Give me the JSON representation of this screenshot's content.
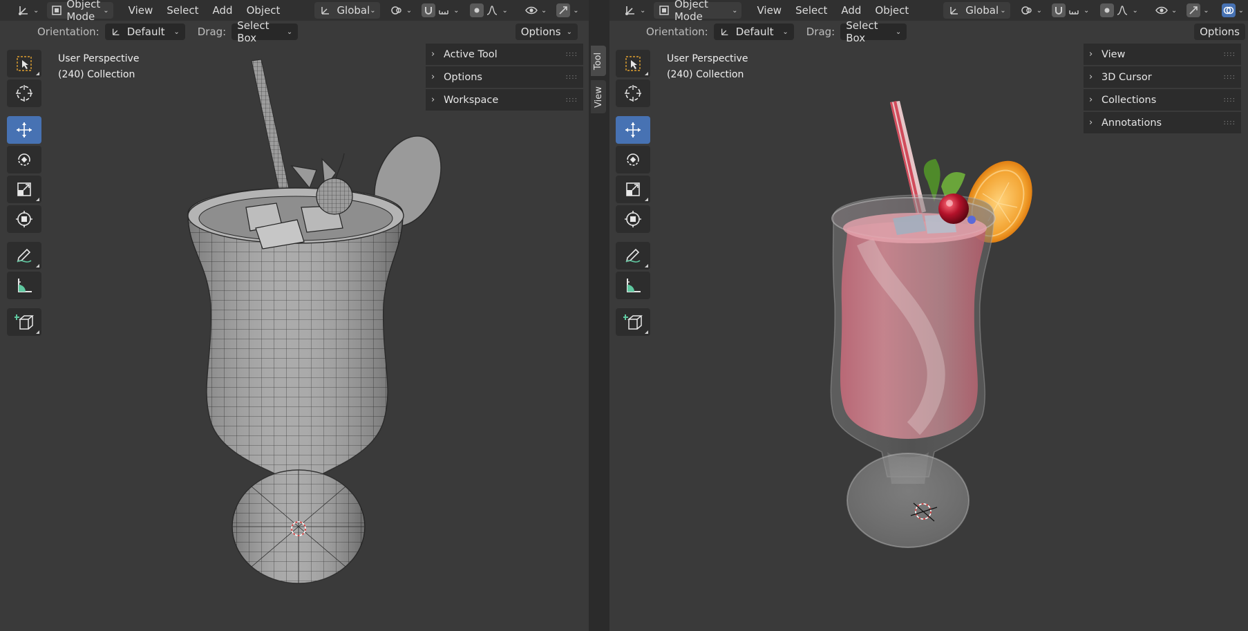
{
  "left": {
    "header": {
      "mode": "Object Mode",
      "menus": [
        "View",
        "Select",
        "Add",
        "Object"
      ],
      "transform_orientation": "Global"
    },
    "tool_header": {
      "orientation_label": "Orientation:",
      "orientation_value": "Default",
      "drag_label": "Drag:",
      "drag_value": "Select Box",
      "options_label": "Options"
    },
    "viewport_info": {
      "view": "User Perspective",
      "collection": "(240) Collection"
    },
    "sidebar_panels": [
      "Active Tool",
      "Options",
      "Workspace"
    ],
    "sidebar_tabs": [
      "Tool",
      "View"
    ]
  },
  "right": {
    "header": {
      "mode": "Object Mode",
      "menus": [
        "View",
        "Select",
        "Add",
        "Object"
      ],
      "transform_orientation": "Global"
    },
    "tool_header": {
      "orientation_label": "Orientation:",
      "orientation_value": "Default",
      "drag_label": "Drag:",
      "drag_value": "Select Box",
      "options_label": "Options"
    },
    "viewport_info": {
      "view": "User Perspective",
      "collection": "(240) Collection"
    },
    "sidebar_panels": [
      "View",
      "3D Cursor",
      "Collections",
      "Annotations"
    ]
  },
  "toolbar_tools": [
    "select-box",
    "cursor",
    "move",
    "rotate",
    "scale",
    "transform",
    "annotate",
    "measure",
    "add-cube"
  ],
  "colors": {
    "active_tool": "#4772b3",
    "viewport_bg": "#3a3a3a",
    "header_bg": "#303030",
    "drink_pink": "#e99aa8",
    "orange": "#f2a12e",
    "cherry": "#b3122a"
  }
}
